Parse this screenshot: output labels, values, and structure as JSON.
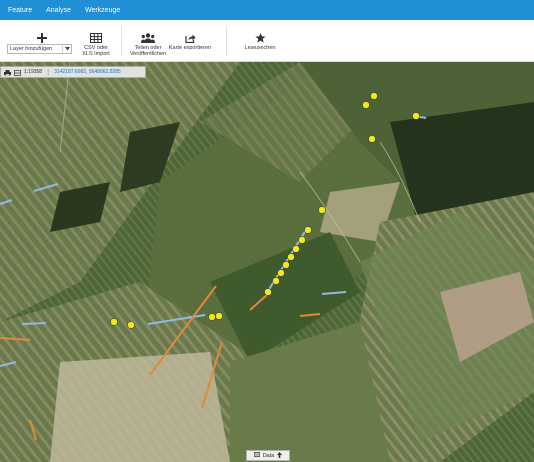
{
  "menu": {
    "items": [
      {
        "label": "Feature"
      },
      {
        "label": "Analyse"
      },
      {
        "label": "Werkzeuge"
      }
    ]
  },
  "toolbar": {
    "add_layer_label": "Layer hinzufügen",
    "csv_label": "CSV oder\nXLS Import",
    "share_label": "Teilen oder\nVeröffentlichen",
    "export_label": "Karte exportieren",
    "bookmark_label": "Lesezeichen"
  },
  "coordbar": {
    "scale": "1:19358",
    "coords": "3142187.6982, 5648862.8285"
  },
  "databar": {
    "label": "Data"
  },
  "colors": {
    "accent": "#1f8fd6",
    "point": "#f2e81f",
    "line_blue": "#8fb9e6",
    "line_orange": "#e08a3a"
  },
  "icons": [
    "plus-icon",
    "table-icon",
    "users-icon",
    "share-export-icon",
    "star-icon",
    "print-icon",
    "layers-icon",
    "grid-icon",
    "arrow-up-icon"
  ]
}
